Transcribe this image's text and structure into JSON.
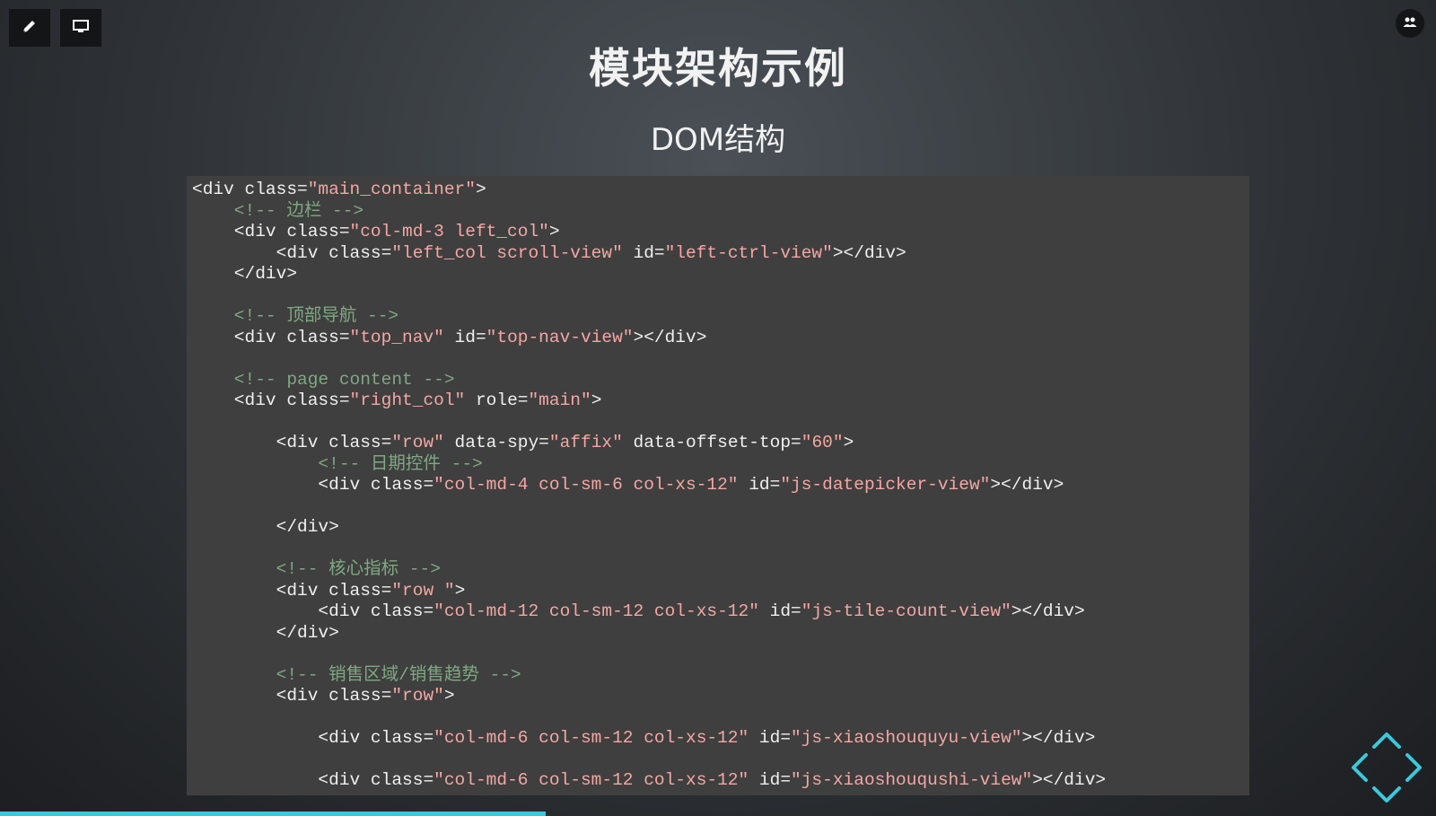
{
  "toolbar": {
    "pen_icon": "pen-icon",
    "screen_icon": "monitor-icon",
    "people_icon": "people-icon"
  },
  "slide": {
    "title": "模块架构示例",
    "subtitle": "DOM结构"
  },
  "code": {
    "lines": [
      [
        {
          "t": "tag",
          "v": "<div class="
        },
        {
          "t": "str",
          "v": "\"main_container\""
        },
        {
          "t": "tag",
          "v": ">"
        }
      ],
      [
        {
          "t": "com",
          "v": "    <!-- 边栏 -->"
        }
      ],
      [
        {
          "t": "tag",
          "v": "    <div class="
        },
        {
          "t": "str",
          "v": "\"col-md-3 left_col\""
        },
        {
          "t": "tag",
          "v": ">"
        }
      ],
      [
        {
          "t": "tag",
          "v": "        <div class="
        },
        {
          "t": "str",
          "v": "\"left_col scroll-view\""
        },
        {
          "t": "tag",
          "v": " id="
        },
        {
          "t": "str",
          "v": "\"left-ctrl-view\""
        },
        {
          "t": "tag",
          "v": "></div>"
        }
      ],
      [
        {
          "t": "tag",
          "v": "    </div>"
        }
      ],
      [],
      [
        {
          "t": "com",
          "v": "    <!-- 顶部导航 -->"
        }
      ],
      [
        {
          "t": "tag",
          "v": "    <div class="
        },
        {
          "t": "str",
          "v": "\"top_nav\""
        },
        {
          "t": "tag",
          "v": " id="
        },
        {
          "t": "str",
          "v": "\"top-nav-view\""
        },
        {
          "t": "tag",
          "v": "></div>"
        }
      ],
      [],
      [
        {
          "t": "com",
          "v": "    <!-- page content -->"
        }
      ],
      [
        {
          "t": "tag",
          "v": "    <div class="
        },
        {
          "t": "str",
          "v": "\"right_col\""
        },
        {
          "t": "tag",
          "v": " role="
        },
        {
          "t": "str",
          "v": "\"main\""
        },
        {
          "t": "tag",
          "v": ">"
        }
      ],
      [],
      [
        {
          "t": "tag",
          "v": "        <div class="
        },
        {
          "t": "str",
          "v": "\"row\""
        },
        {
          "t": "tag",
          "v": " data-spy="
        },
        {
          "t": "str",
          "v": "\"affix\""
        },
        {
          "t": "tag",
          "v": " data-offset-top="
        },
        {
          "t": "str",
          "v": "\"60\""
        },
        {
          "t": "tag",
          "v": ">"
        }
      ],
      [
        {
          "t": "com",
          "v": "            <!-- 日期控件 -->"
        }
      ],
      [
        {
          "t": "tag",
          "v": "            <div class="
        },
        {
          "t": "str",
          "v": "\"col-md-4 col-sm-6 col-xs-12\""
        },
        {
          "t": "tag",
          "v": " id="
        },
        {
          "t": "str",
          "v": "\"js-datepicker-view\""
        },
        {
          "t": "tag",
          "v": "></div>"
        }
      ],
      [],
      [
        {
          "t": "tag",
          "v": "        </div>"
        }
      ],
      [],
      [
        {
          "t": "com",
          "v": "        <!-- 核心指标 -->"
        }
      ],
      [
        {
          "t": "tag",
          "v": "        <div class="
        },
        {
          "t": "str",
          "v": "\"row \""
        },
        {
          "t": "tag",
          "v": ">"
        }
      ],
      [
        {
          "t": "tag",
          "v": "            <div class="
        },
        {
          "t": "str",
          "v": "\"col-md-12 col-sm-12 col-xs-12\""
        },
        {
          "t": "tag",
          "v": " id="
        },
        {
          "t": "str",
          "v": "\"js-tile-count-view\""
        },
        {
          "t": "tag",
          "v": "></div>"
        }
      ],
      [
        {
          "t": "tag",
          "v": "        </div>"
        }
      ],
      [],
      [
        {
          "t": "com",
          "v": "        <!-- 销售区域/销售趋势 -->"
        }
      ],
      [
        {
          "t": "tag",
          "v": "        <div class="
        },
        {
          "t": "str",
          "v": "\"row\""
        },
        {
          "t": "tag",
          "v": ">"
        }
      ],
      [],
      [
        {
          "t": "tag",
          "v": "            <div class="
        },
        {
          "t": "str",
          "v": "\"col-md-6 col-sm-12 col-xs-12\""
        },
        {
          "t": "tag",
          "v": " id="
        },
        {
          "t": "str",
          "v": "\"js-xiaoshouquyu-view\""
        },
        {
          "t": "tag",
          "v": "></div>"
        }
      ],
      [],
      [
        {
          "t": "tag",
          "v": "            <div class="
        },
        {
          "t": "str",
          "v": "\"col-md-6 col-sm-12 col-xs-12\""
        },
        {
          "t": "tag",
          "v": " id="
        },
        {
          "t": "str",
          "v": "\"js-xiaoshouqushi-view\""
        },
        {
          "t": "tag",
          "v": "></div>"
        }
      ]
    ]
  },
  "progress": {
    "fraction": 0.38
  },
  "navigation": {
    "icon": "navigate-arrows-icon"
  },
  "colors": {
    "accent": "#3cc8dc",
    "string": "#f4a7a4",
    "comment": "#7fa882"
  }
}
